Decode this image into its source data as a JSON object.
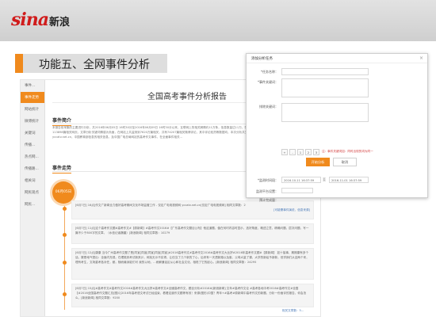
{
  "brand": {
    "logo_text": "sina",
    "logo_cn": "新浪",
    "color": "#d01b1b"
  },
  "section_title": "功能五、全网事件分析",
  "accent_color": "#f08a1d",
  "sidebar": {
    "items": [
      {
        "label": "事件..."
      },
      {
        "label": "事件走势"
      },
      {
        "label": "网站统计"
      },
      {
        "label": "微博统计"
      },
      {
        "label": "关键词"
      },
      {
        "label": "传播..."
      },
      {
        "label": "热点网..."
      },
      {
        "label": "传播路..."
      },
      {
        "label": "相关词"
      },
      {
        "label": "网民观点"
      },
      {
        "label": "网民..."
      }
    ]
  },
  "report": {
    "title": "全国高考事件分析报告",
    "summary_heading": "事件简介",
    "summary_text": "本报告依采集的主要进行分析，共2016年06月05日 16时30分至2016年06月09日 16时30分以来，互联网上的相关舆情约11万条，信息数量达11万，在今年高考中的网站信息为主。共计113898篇相关网页，文章分析关键词情感为负面，在网站上共监测到7620万篇相关，共有74207篇相关微博评论，其中评论较热等数据均，本次分析共关注到高考事件信息网站yccatv.net.cn，中国教育部信息的相关信息，及中国广电总局网站的高考作文事件，在全面事件相关...",
    "trend_heading": "事件走势",
    "start_label": "06月05日",
    "cards": [
      {
        "text": "[6月7日] 16点[作文广新闻全力做好高考期间文化市场监管工作 - 仅定广电电视频网 yccatv.net.cn[仅定广电电视频网] 相同文章数：2",
        "more": "[可能需事件演说，信息来源]"
      },
      {
        "text": "[6月7日] 11点[这个高考作文题#高考作文#【原新闻】#高考作文2016#【广东高考作文题目公布】他这道题，值在何时内容时显示，选好角度，概述立意，精确问题，层次问题，写一篇不少于800字的文章。（水信记者魏晨）[新浪新闻] 相同文章数：10279",
        "more": ""
      },
      {
        "text": "[6月7日] 12点[康康 当今广州高考作文题了是[同宣[同宣[同宣]同宣[同宣]#2016高考作文#高考作文2016#高考作文大比拼#2016年高考作文题#【原新闻】 如十接事、期期康有多个话、赛是地气很出：全面内充观，在理推其考试新其计，网找无示不实得，让但当了几个新的了心，后来有一天透新路以及客，父母大量了课，大学的新绘予新新，但学我们从这两个来，理有考生，文场重考各对任，都，随而最深能们可 我的以地，...而解通话区从心和社会文化，相现了它的起心。[新浪新闻] 相同文章数：24295",
        "more": ""
      },
      {
        "text": "[6月7日] 15点[#高考作文#高考作文2016#高考作文大比拼#高考作文#全國高考作文，题目分析#2016#[新浪新闻] 文年#高考作文论 #高考各地中考2016#高考作文#全国 【#2016全国高考作文题汇总[图片]2016年高考语文考试已经结束，看看这道作文题等有效！来源(图形)中国？青年+#高考#原新闻中高考作文的新题，分析一份面评的报告，你会怎么，[新浪新闻] 相同文章数：9200",
        "more": "相关文章数：5..."
      }
    ],
    "card_link_label": "[可能需事件演说，信息来源]"
  },
  "dialog": {
    "title": "添加分析任务",
    "close_glyph": "×",
    "fields": [
      {
        "label": "*任务名称："
      },
      {
        "label": "*事件关键词："
      },
      {
        "label": "排除关键词："
      },
      {
        "label": "*监测时间段："
      },
      {
        "label": "监测平台设置："
      },
      {
        "label": "预计完成量："
      }
    ],
    "keyword_buttons": [
      "+",
      "-",
      "1",
      "2",
      "3"
    ],
    "keyword_hint": "注：事件关键词如：同时出现的词为同一",
    "date_start": "2016-10-11 16:37:59",
    "date_end": "2016-11-01 16:37:59",
    "date_sep": "至",
    "submit_label": "开始分析",
    "cancel_label": "取消"
  }
}
